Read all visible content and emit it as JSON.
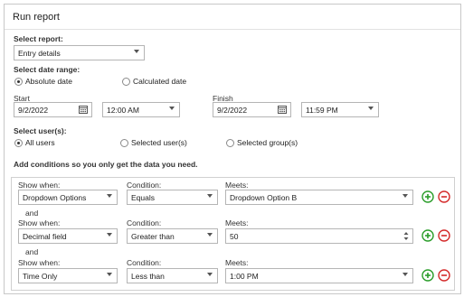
{
  "header": {
    "title": "Run report"
  },
  "report": {
    "label": "Select report:",
    "value": "Entry details"
  },
  "date_range": {
    "label": "Select date range:",
    "options": [
      "Absolute date",
      "Calculated date"
    ],
    "selected": "Absolute date",
    "start_label": "Start",
    "finish_label": "Finish",
    "start_date": "9/2/2022",
    "start_time": "12:00 AM",
    "finish_date": "9/2/2022",
    "finish_time": "11:59 PM"
  },
  "users": {
    "label": "Select user(s):",
    "options": [
      "All users",
      "Selected user(s)",
      "Selected group(s)"
    ],
    "selected": "All users"
  },
  "conditions": {
    "heading": "Add conditions so you only get the data you need.",
    "show_when_label": "Show when:",
    "condition_label": "Condition:",
    "meets_label": "Meets:",
    "joiner": "and",
    "rows": [
      {
        "field": "Dropdown Options",
        "operator": "Equals",
        "meets": "Dropdown Option B"
      },
      {
        "field": "Decimal field",
        "operator": "Greater than",
        "meets": "50"
      },
      {
        "field": "Time Only",
        "operator": "Less than",
        "meets": "1:00 PM"
      }
    ]
  },
  "colors": {
    "add": "#2a9d2a",
    "remove": "#d42a2a",
    "border": "#b5b5b5"
  },
  "icons": {
    "add": "plus-circle-icon",
    "remove": "minus-circle-icon",
    "calendar": "calendar-icon",
    "dropdown": "chevron-down-icon",
    "spinner": "spinner-icon"
  }
}
